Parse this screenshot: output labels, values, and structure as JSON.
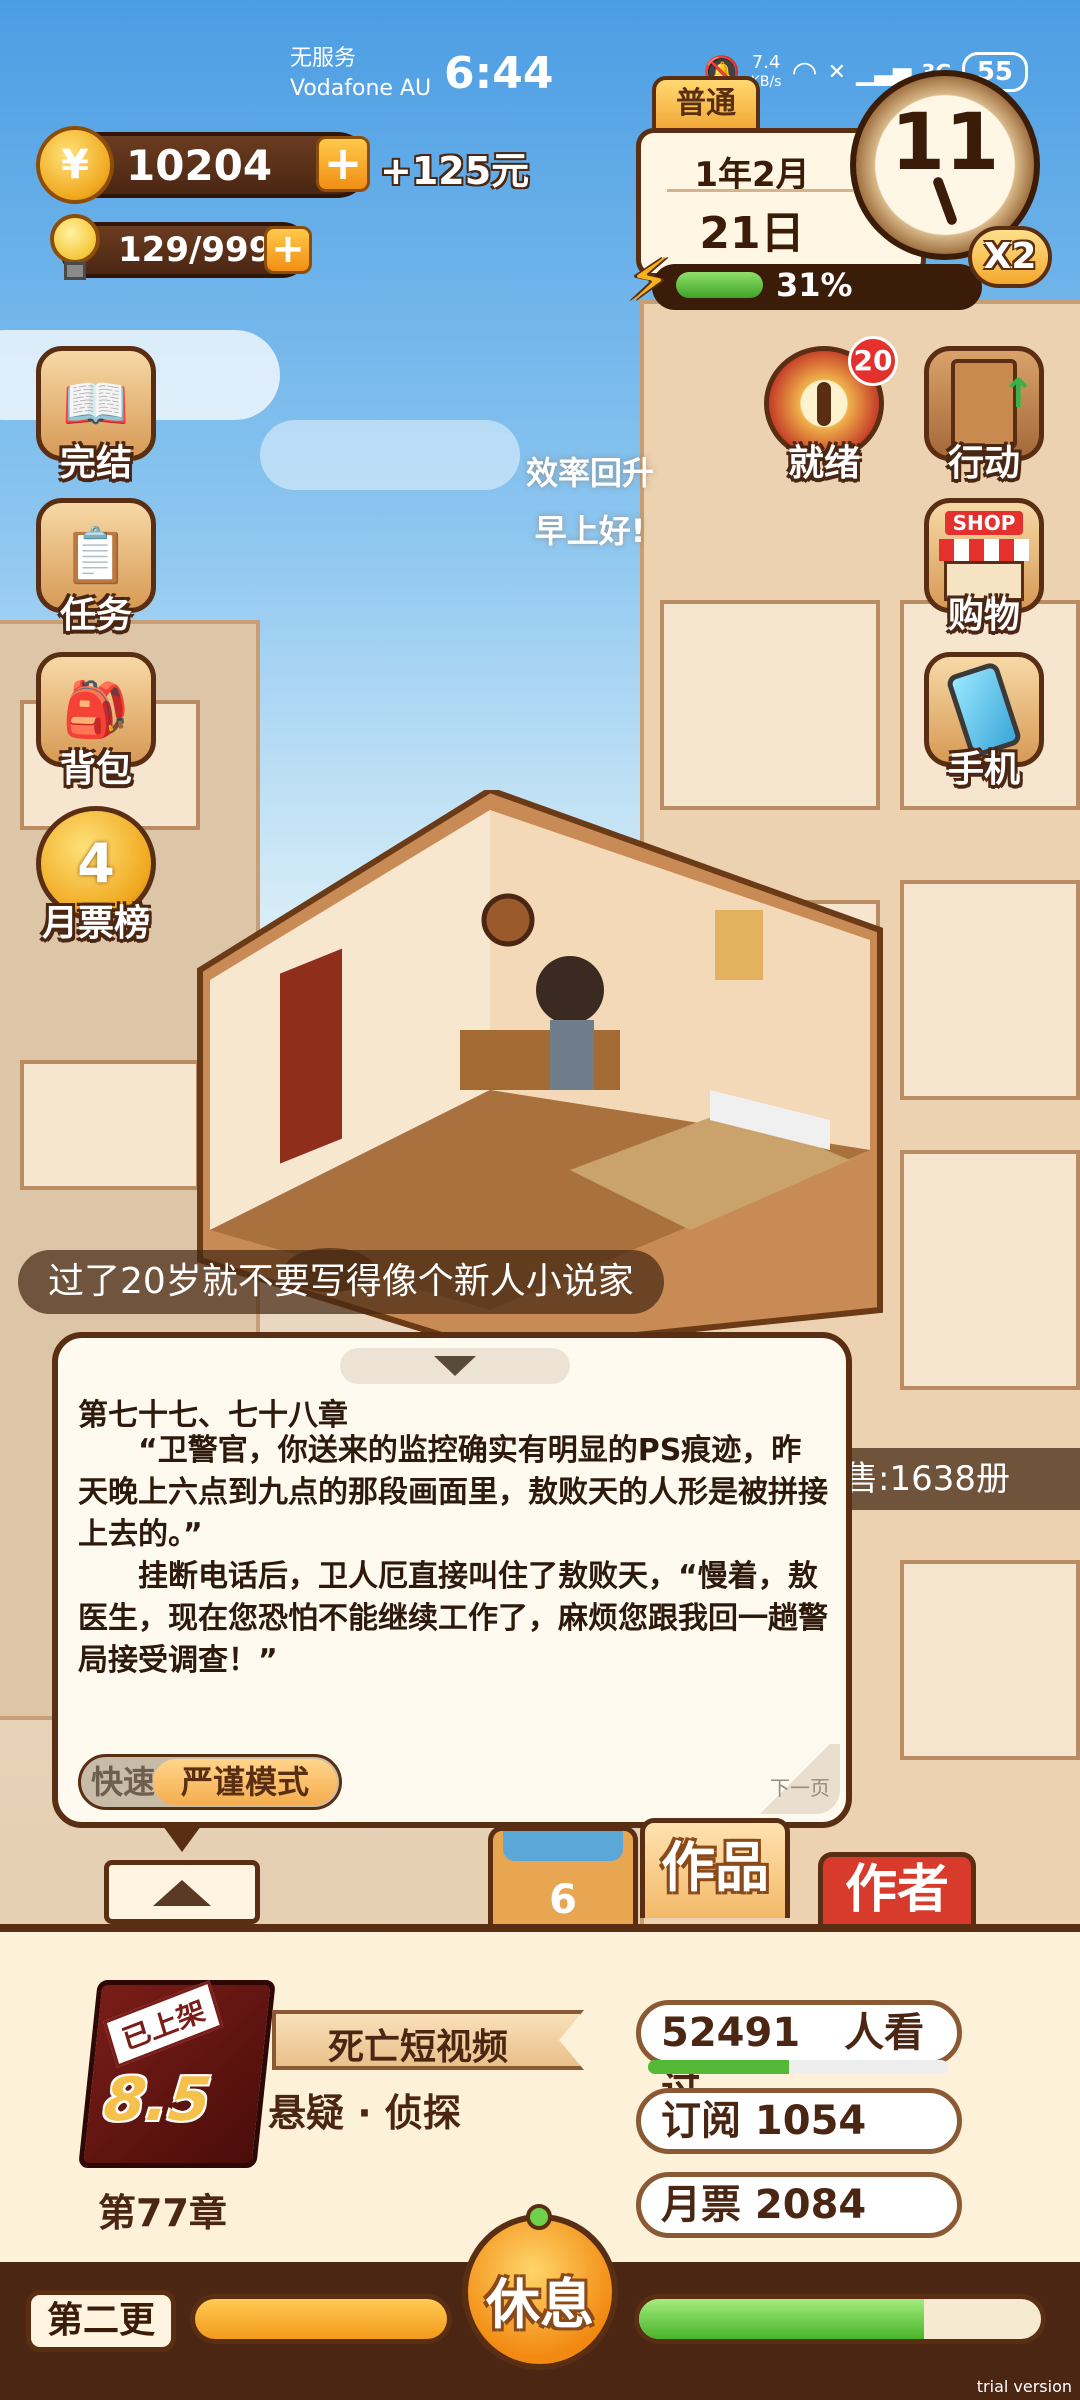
{
  "status_bar": {
    "carrier_line1": "无服务",
    "carrier_line2": "Vodafone AU",
    "time": "6:44",
    "net_speed": "7.4",
    "net_unit": "KB/s",
    "network": "3G",
    "battery": "55"
  },
  "currency": {
    "coins": "10204",
    "coins_income": "+125元",
    "energy": "129/999"
  },
  "calendar": {
    "mode": "普通",
    "year_month": "1年2月",
    "day": "21日",
    "hour": "11",
    "progress_label": "31%",
    "progress_value": 0.31,
    "speed": "X2"
  },
  "left_menu": [
    {
      "label": "完结",
      "icon": "book-icon"
    },
    {
      "label": "任务",
      "icon": "clipboard-icon"
    },
    {
      "label": "背包",
      "icon": "backpack-icon"
    },
    {
      "label": "月票榜",
      "icon": "ranking-coin-icon",
      "rank": "4"
    }
  ],
  "right_menu": [
    {
      "label": "就绪",
      "icon": "fortune-wheel-icon",
      "badge": "20"
    },
    {
      "label": "行动",
      "icon": "door-icon"
    },
    {
      "label": "购物",
      "icon": "shop-icon",
      "sign": "SHOP"
    },
    {
      "label": "手机",
      "icon": "phone-icon"
    }
  ],
  "float_texts": [
    "效率回升",
    "早上好!"
  ],
  "ticker": "过了20岁就不要写得像个新人小说家",
  "sales": "售:1638册",
  "chapter_popup": {
    "title": "第七十七、七十八章",
    "para1": "“卫警官，你送来的监控确实有明显的PS痕迹，昨天晚上六点到九点的那段画面里，敖败天的人形是被拼接上去的。”",
    "para2": "挂断电话后，卫人厄直接叫住了敖败天，“慢着，敖医生，现在您恐怕不能继续工作了，麻烦您跟我回一趟警局接受调查！”",
    "mode_off": "快速",
    "mode_on": "严谨模式",
    "next_page": "下一页"
  },
  "tabs": {
    "center_count": "6",
    "works": "作品",
    "author": "作者"
  },
  "book": {
    "tag": "已上架",
    "rating": "8.5",
    "title": "死亡短视频",
    "genre": "悬疑 · 侦探",
    "chapter": "第77章"
  },
  "stats": {
    "readers": "52491",
    "readers_label": "人看过",
    "readers_progress": 0.47,
    "subscribe": "订阅 1054",
    "monthly": "月票 2084"
  },
  "action_bar": {
    "update_label": "第二更",
    "rest_label": "休息",
    "update_progress": 1.0,
    "rest_progress": 0.71
  },
  "watermark": "trial version",
  "colors": {
    "dark_brown": "#5a2e12",
    "accent_orange": "#f2a937",
    "energy_green": "#53b936",
    "badge_red": "#e4312d"
  }
}
